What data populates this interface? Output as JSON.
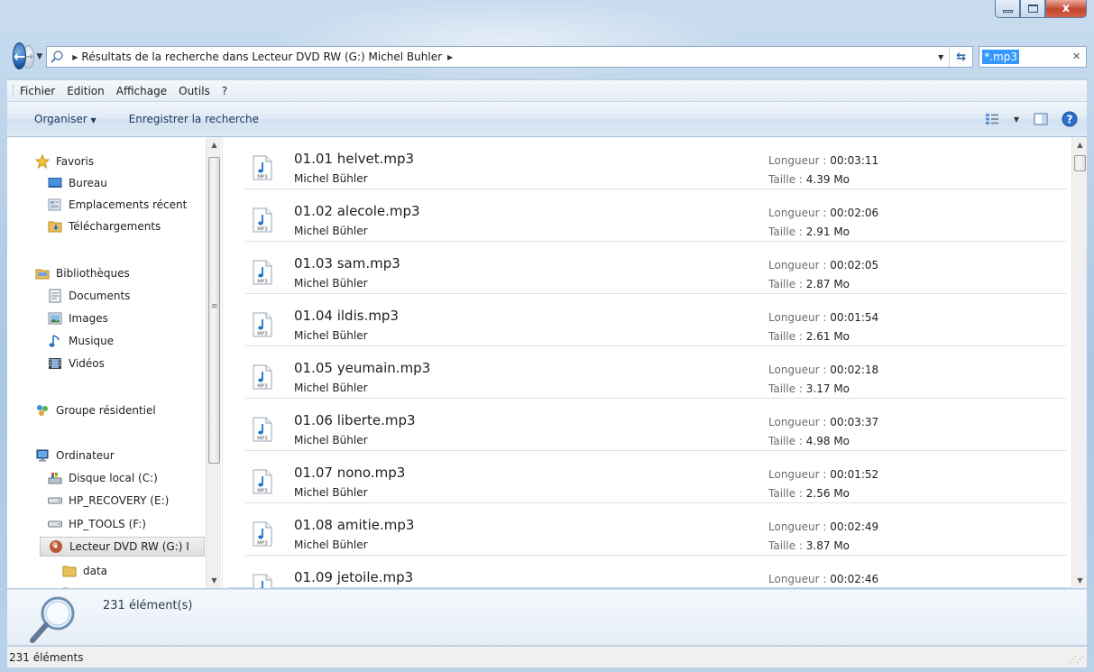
{
  "window": {
    "close_glyph": "x"
  },
  "address": {
    "path": "Résultats de la recherche dans Lecteur DVD RW (G:) Michel Buhler"
  },
  "search": {
    "value": "*.mp3"
  },
  "menu": {
    "items": [
      "Fichier",
      "Edition",
      "Affichage",
      "Outils",
      "?"
    ]
  },
  "commands": {
    "organize": "Organiser",
    "save_search": "Enregistrer la recherche"
  },
  "nav": {
    "favorites": "Favoris",
    "desktop": "Bureau",
    "recent": "Emplacements récent",
    "downloads": "Téléchargements",
    "libraries": "Bibliothèques",
    "documents": "Documents",
    "images": "Images",
    "music": "Musique",
    "videos": "Vidéos",
    "homegroup": "Groupe résidentiel",
    "computer": "Ordinateur",
    "disk_c": "Disque local (C:)",
    "disk_e": "HP_RECOVERY (E:)",
    "disk_f": "HP_TOOLS (F:)",
    "disk_g": "Lecteur DVD RW (G:) I",
    "data": "data"
  },
  "labels": {
    "length": "Longueur :",
    "size": "Taille :"
  },
  "files": [
    {
      "name": "01.01 helvet.mp3",
      "artist": "Michel Bühler",
      "length": "00:03:11",
      "size": "4.39 Mo"
    },
    {
      "name": "01.02 alecole.mp3",
      "artist": "Michel Bühler",
      "length": "00:02:06",
      "size": "2.91 Mo"
    },
    {
      "name": "01.03 sam.mp3",
      "artist": "Michel Bühler",
      "length": "00:02:05",
      "size": "2.87 Mo"
    },
    {
      "name": "01.04 ildis.mp3",
      "artist": "Michel Bühler",
      "length": "00:01:54",
      "size": "2.61 Mo"
    },
    {
      "name": "01.05 yeumain.mp3",
      "artist": "Michel Bühler",
      "length": "00:02:18",
      "size": "3.17 Mo"
    },
    {
      "name": "01.06 liberte.mp3",
      "artist": "Michel Bühler",
      "length": "00:03:37",
      "size": "4.98 Mo"
    },
    {
      "name": "01.07 nono.mp3",
      "artist": "Michel Bühler",
      "length": "00:01:52",
      "size": "2.56 Mo"
    },
    {
      "name": "01.08 amitie.mp3",
      "artist": "Michel Bühler",
      "length": "00:02:49",
      "size": "3.87 Mo"
    },
    {
      "name": "01.09 jetoile.mp3",
      "artist": "",
      "length": "00:02:46",
      "size": ""
    }
  ],
  "details": {
    "count": "231 élément(s)"
  },
  "status": {
    "text": "231 éléments"
  }
}
